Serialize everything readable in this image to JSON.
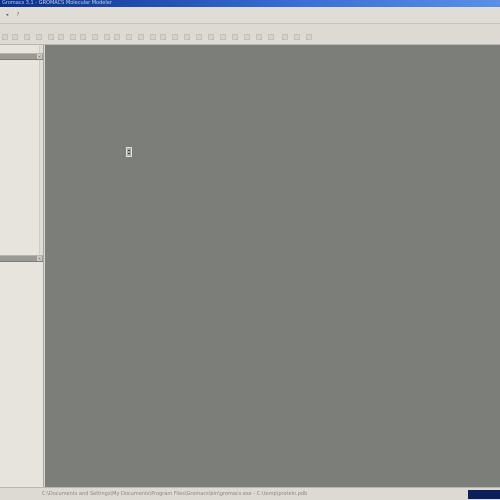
{
  "window": {
    "title": "Gromacs 3.1 - GROMACS Molecular Modeler"
  },
  "menubar": {
    "buttons": [
      {
        "name": "back-icon",
        "glyph": "◂"
      },
      {
        "name": "help-icon",
        "glyph": "?"
      }
    ]
  },
  "left_pane": {
    "top_section": {
      "close_label": "×"
    },
    "bottom_section": {
      "close_label": "×"
    }
  },
  "statusbar": {
    "path": "C:\\Documents and Settings\\My Documents\\Program Files\\Gromacs\\bin\\gromacs.exe - C:\\temp\\protein.pdb"
  },
  "colors": {
    "titlebar": "#0a2f8c",
    "workspace": "#7c7e79",
    "chrome": "#dcdad3"
  }
}
